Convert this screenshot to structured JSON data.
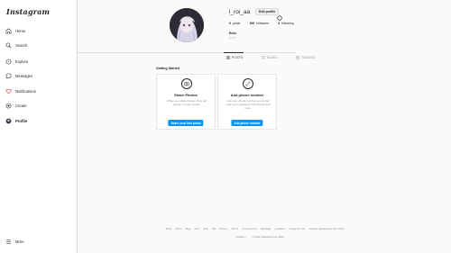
{
  "app": {
    "logo": "Instagram"
  },
  "sidebar": {
    "items": [
      {
        "label": "Home",
        "icon": "home-icon"
      },
      {
        "label": "Search",
        "icon": "search-icon"
      },
      {
        "label": "Explore",
        "icon": "compass-icon"
      },
      {
        "label": "Messages",
        "icon": "messenger-icon"
      },
      {
        "label": "Notifications",
        "icon": "heart-icon"
      },
      {
        "label": "Create",
        "icon": "plus-square-icon"
      },
      {
        "label": "Profile",
        "icon": "avatar-icon"
      }
    ],
    "more": {
      "label": "More",
      "icon": "menu-icon"
    }
  },
  "profile": {
    "username": "i_roi_aa",
    "edit_label": "Edit profile",
    "stats": {
      "posts_count": "0",
      "posts_label": "posts",
      "followers_count": "199",
      "followers_label": "followers",
      "following_count": "4",
      "following_label": "following"
    },
    "bio_name": "Rolu",
    "bio_text": "♡♡"
  },
  "tabs": [
    {
      "label": "POSTS",
      "active": true
    },
    {
      "label": "SAVED",
      "active": false
    },
    {
      "label": "TAGGED",
      "active": false
    }
  ],
  "getting_started": {
    "heading": "Getting Started",
    "cards": [
      {
        "icon": "camera-icon",
        "title": "Share Photos",
        "text": "When you share photos, they will appear on your profile.",
        "button": "Share your first photo"
      },
      {
        "icon": "link-icon",
        "title": "Add phone number",
        "text": "Add your phone number so you can reset your password, find friends and more.",
        "button": "Add phone number"
      }
    ]
  },
  "footer": {
    "links": [
      "Meta",
      "About",
      "Blog",
      "Jobs",
      "Help",
      "API",
      "Privacy",
      "Terms",
      "Top Accounts",
      "Hashtags",
      "Locations",
      "Instagram Lite",
      "Contact Uploading & Non-Users"
    ],
    "language": "English ⌄",
    "copyright": "© 2022 Instagram from Meta"
  }
}
